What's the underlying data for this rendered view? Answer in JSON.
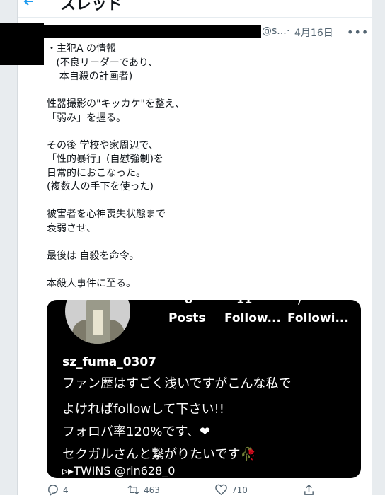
{
  "header": {
    "title": "スレッド"
  },
  "tweet": {
    "handle": "@s...",
    "separator": "·",
    "date": "4月16日",
    "more": "•••",
    "lines": [
      "・主犯A の情報",
      "   (不良リーダーであり、",
      "    本自殺の計画者)",
      "",
      "性器撮影の\"キッカケ\"を整え、",
      "「弱み」を握る。",
      "",
      "その後 学校や家周辺で、",
      "「性的暴行」(自慰強制)を",
      "日常的におこなった。",
      "(複数人の手下を使った)",
      "",
      "被害者を心神喪失状態まで",
      "衰弱させ、",
      "",
      "最後は 自殺を命令。",
      "",
      "本殺人事件に至る。"
    ]
  },
  "media": {
    "stats": [
      "Posts",
      "Follow...",
      "Followi..."
    ],
    "username": "sz_fuma_0307",
    "bio": [
      "ファン歴はすごく浅いですがこんな私で",
      "よければfollowして下さい!!",
      "フォロバ率120%です、❤︎",
      "セクガルさんと繋がりたいです🥀",
      "▹▸TWINS @rin628_0"
    ]
  },
  "actions": {
    "reply_count": "4",
    "retweet_count": "463",
    "like_count": "710"
  }
}
